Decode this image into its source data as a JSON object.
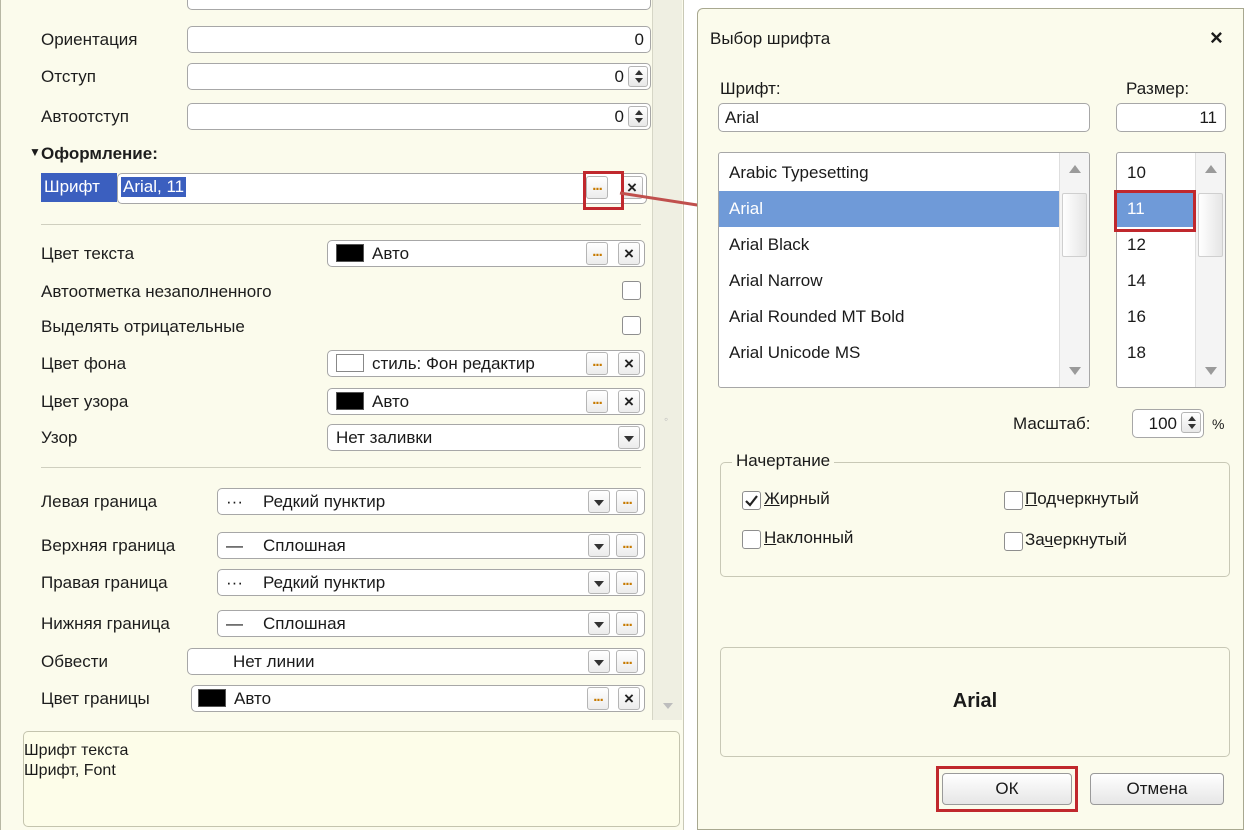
{
  "properties": {
    "orientation": {
      "label": "Ориентация",
      "value": "0"
    },
    "indent": {
      "label": "Отступ",
      "value": "0"
    },
    "auto_indent": {
      "label": "Автоотступ",
      "value": "0"
    },
    "section_title": "Оформление:",
    "font": {
      "label": "Шрифт",
      "value": "Arial, 11"
    },
    "text_color": {
      "label": "Цвет текста",
      "value": "Авто",
      "swatch": "#000000"
    },
    "auto_mark_empty": {
      "label": "Автоотметка незаполненного"
    },
    "highlight_negative": {
      "label": "Выделять отрицательные"
    },
    "back_color": {
      "label": "Цвет фона",
      "value": "стиль: Фон редактир",
      "swatch": "#ffffff"
    },
    "pattern_color": {
      "label": "Цвет узора",
      "value": "Авто",
      "swatch": "#000000"
    },
    "pattern": {
      "label": "Узор",
      "value": "Нет заливки"
    },
    "left_border": {
      "label": "Левая граница",
      "value": "Редкий пунктир",
      "glyph": "···"
    },
    "top_border": {
      "label": "Верхняя граница",
      "value": "Сплошная",
      "glyph": "—"
    },
    "right_border": {
      "label": "Правая граница",
      "value": "Редкий пунктир",
      "glyph": "···"
    },
    "bottom_border": {
      "label": "Нижняя граница",
      "value": "Сплошная",
      "glyph": "—"
    },
    "outline": {
      "label": "Обвести",
      "value": "Нет линии"
    },
    "border_color": {
      "label": "Цвет границы",
      "value": "Авто",
      "swatch": "#000000"
    }
  },
  "help": {
    "line1": "Шрифт текста",
    "line2": "Шрифт, Font"
  },
  "dialog": {
    "title": "Выбор шрифта",
    "close": "×",
    "font_label": "Шрифт:",
    "font_value": "Arial",
    "size_label": "Размер:",
    "size_value": "11",
    "fonts": [
      "Arabic Typesetting",
      "Arial",
      "Arial Black",
      "Arial Narrow",
      "Arial Rounded MT Bold",
      "Arial Unicode MS"
    ],
    "selected_font": "Arial",
    "sizes": [
      "10",
      "11",
      "12",
      "14",
      "16",
      "18"
    ],
    "selected_size": "11",
    "scale_label": "Масштаб:",
    "scale_value": "100",
    "scale_unit": "%",
    "style_group": "Начертание",
    "bold": {
      "label_key": "Ж",
      "label_rest": "ирный",
      "checked": true
    },
    "italic": {
      "label_key": "Н",
      "label_rest": "аклонный",
      "checked": false
    },
    "underline": {
      "label_key": "П",
      "label_rest": "одчеркнутый",
      "checked": false
    },
    "strike": {
      "label_pre": "За",
      "label_key": "ч",
      "label_rest": "еркнутый",
      "checked": false
    },
    "preview": "Arial",
    "ok": "ОК",
    "cancel": "Отмена"
  },
  "colors": {
    "selection": "#6f9ad8",
    "highlight": "#c0282d",
    "arrow": "#c0504d",
    "panel_bg": "#fbfbec"
  }
}
